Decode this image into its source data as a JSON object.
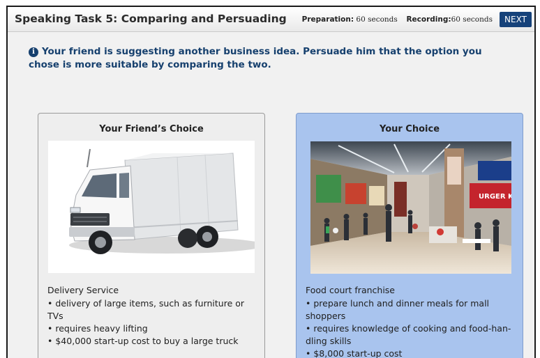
{
  "header": {
    "title": "Speaking Task 5: Comparing and Persuading",
    "preparation_label": "Preparation:",
    "preparation_value": "60 seconds",
    "recording_label": "Recording:",
    "recording_value": "60 seconds",
    "next_label": "NEXT"
  },
  "prompt": {
    "icon": "info-icon",
    "icon_glyph": "i",
    "text": "Your friend is suggesting another business idea. Persuade him that the option you chose is more suitable by comparing the two."
  },
  "left_card": {
    "title": "Your Friend’s Choice",
    "image": "delivery-truck-photo",
    "heading": "Delivery Service",
    "bullets": [
      "delivery of large items, such as furniture or TVs",
      "requires heavy lifting",
      "$40,000 start-up cost to buy a large truck"
    ]
  },
  "right_card": {
    "title": "Your Choice",
    "image": "food-court-photo",
    "sign_text": "URGER KING",
    "heading": "Food court franchise",
    "bullets": [
      "prepare lunch and dinner meals for mall shoppers",
      "requires knowledge of cooking and food-han-dling skills",
      "$8,000 start-up cost"
    ]
  },
  "colors": {
    "accent": "#16427a",
    "prompt": "#16406e",
    "selected_card": "#a9c4ee",
    "unselected_card": "#eeeeee"
  }
}
